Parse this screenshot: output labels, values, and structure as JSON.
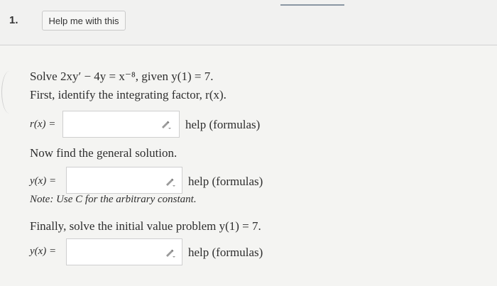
{
  "header": {
    "question_number": "1.",
    "help_button_label": "Help me with this"
  },
  "problem": {
    "statement": "Solve 2xy′ − 4y = x⁻⁸, given y(1) = 7.",
    "step1": "First, identify the integrating factor, r(x).",
    "step2": "Now find the general solution.",
    "note": "Note: Use C for the arbitrary constant.",
    "step3": "Finally, solve the initial value problem y(1) = 7."
  },
  "fields": [
    {
      "label": "r(x) =",
      "value": "",
      "help": "help (formulas)",
      "icon": "pencil-icon"
    },
    {
      "label": "y(x) =",
      "value": "",
      "help": "help (formulas)",
      "icon": "pencil-icon"
    },
    {
      "label": "y(x) =",
      "value": "",
      "help": "help (formulas)",
      "icon": "pencil-icon"
    }
  ]
}
